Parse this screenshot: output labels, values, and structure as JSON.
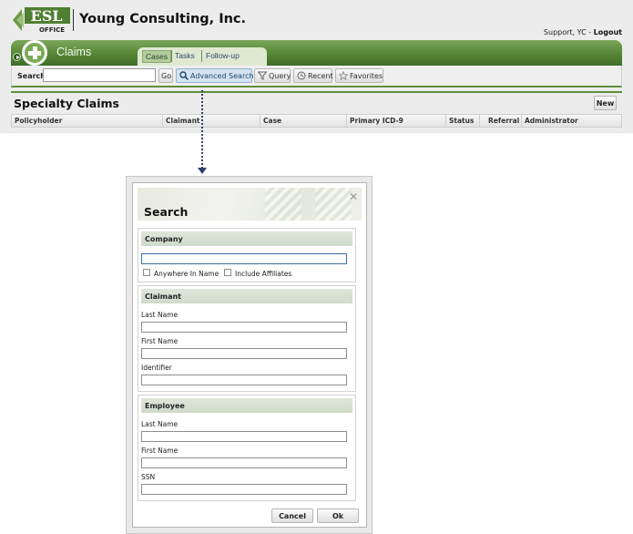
{
  "app": {
    "logo_text_top": "ESL",
    "logo_text_bottom": "OFFICE",
    "company_name": "Young Consulting, Inc.",
    "support_link": "Support, YC",
    "separator": " - ",
    "logout_link": "Logout",
    "brand_color": "#5c8c3c"
  },
  "nav": {
    "module_title": "Claims",
    "tabs": [
      {
        "label": "Cases",
        "active": true
      },
      {
        "label": "Tasks",
        "active": false
      },
      {
        "label": "Follow-up",
        "active": false
      }
    ]
  },
  "toolbar": {
    "search_label": "Search",
    "search_value": "",
    "go_label": "Go",
    "advanced_search_label": "Advanced Search",
    "query_label": "Query",
    "recent_label": "Recent",
    "favorites_label": "Favorites"
  },
  "section": {
    "title": "Specialty Claims",
    "new_label": "New",
    "columns": [
      "Policyholder",
      "Claimant",
      "Case",
      "Primary ICD-9",
      "Status",
      "Referral",
      "Administrator"
    ]
  },
  "dialog": {
    "title": "Search",
    "close_icon": "close-icon",
    "company": {
      "heading": "Company",
      "value": "",
      "anywhere_label": "Anywhere In Name",
      "affiliates_label": "Include Affiliates"
    },
    "claimant": {
      "heading": "Claimant",
      "last_name_label": "Last Name",
      "first_name_label": "First Name",
      "identifier_label": "Identifier"
    },
    "employee": {
      "heading": "Employee",
      "last_name_label": "Last Name",
      "first_name_label": "First Name",
      "ssn_label": "SSN"
    },
    "cancel_label": "Cancel",
    "ok_label": "Ok"
  }
}
